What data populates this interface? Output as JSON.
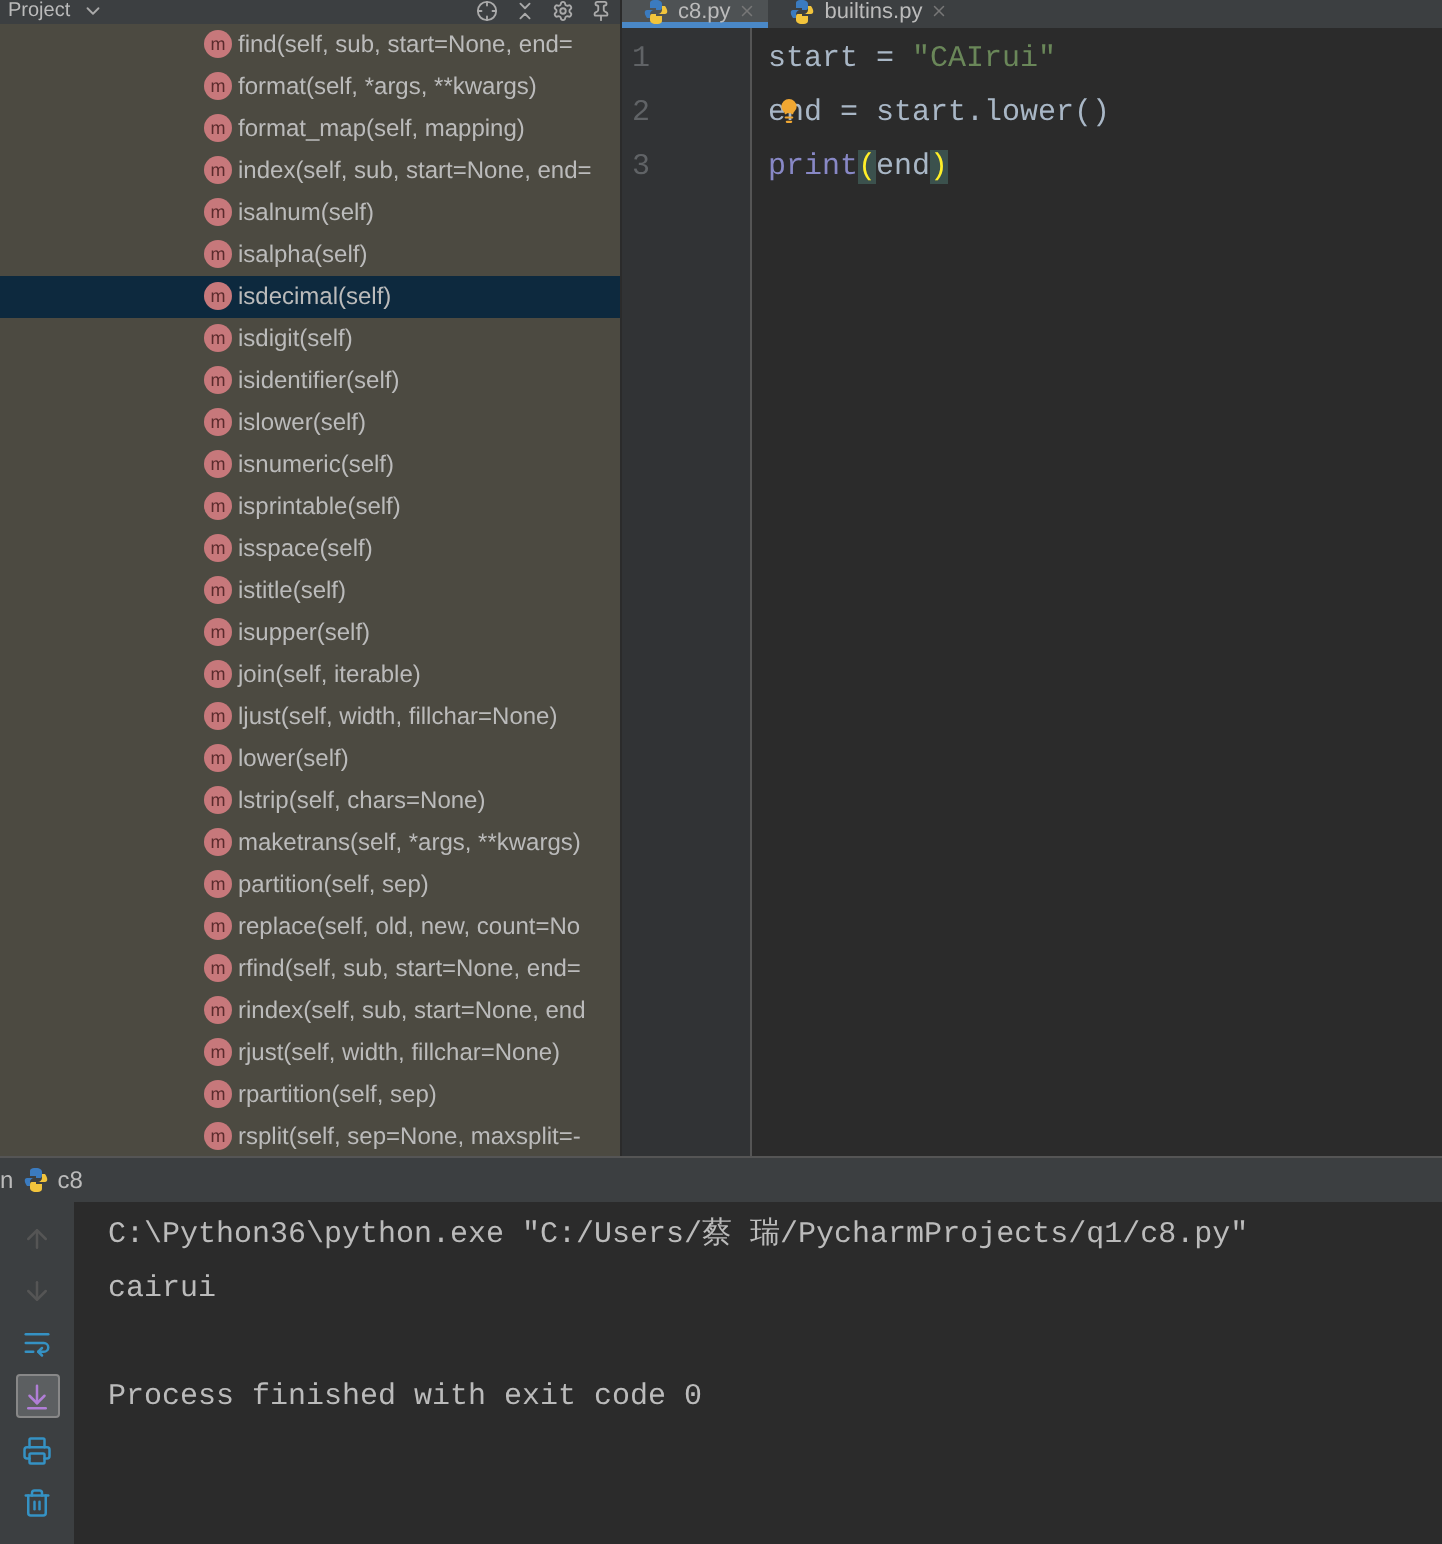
{
  "project_panel": {
    "title": "Project",
    "members": [
      {
        "icon": "m",
        "label": "find(self, sub, start=None, end=",
        "selected": false
      },
      {
        "icon": "m",
        "label": "format(self, *args, **kwargs)",
        "selected": false
      },
      {
        "icon": "m",
        "label": "format_map(self, mapping)",
        "selected": false
      },
      {
        "icon": "m",
        "label": "index(self, sub, start=None, end=",
        "selected": false
      },
      {
        "icon": "m",
        "label": "isalnum(self)",
        "selected": false
      },
      {
        "icon": "m",
        "label": "isalpha(self)",
        "selected": false
      },
      {
        "icon": "m",
        "label": "isdecimal(self)",
        "selected": true
      },
      {
        "icon": "m",
        "label": "isdigit(self)",
        "selected": false
      },
      {
        "icon": "m",
        "label": "isidentifier(self)",
        "selected": false
      },
      {
        "icon": "m",
        "label": "islower(self)",
        "selected": false
      },
      {
        "icon": "m",
        "label": "isnumeric(self)",
        "selected": false
      },
      {
        "icon": "m",
        "label": "isprintable(self)",
        "selected": false
      },
      {
        "icon": "m",
        "label": "isspace(self)",
        "selected": false
      },
      {
        "icon": "m",
        "label": "istitle(self)",
        "selected": false
      },
      {
        "icon": "m",
        "label": "isupper(self)",
        "selected": false
      },
      {
        "icon": "m",
        "label": "join(self, iterable)",
        "selected": false
      },
      {
        "icon": "m",
        "label": "ljust(self, width, fillchar=None)",
        "selected": false
      },
      {
        "icon": "m",
        "label": "lower(self)",
        "selected": false
      },
      {
        "icon": "m",
        "label": "lstrip(self, chars=None)",
        "selected": false
      },
      {
        "icon": "m",
        "label": "maketrans(self, *args, **kwargs)",
        "selected": false
      },
      {
        "icon": "m",
        "label": "partition(self, sep)",
        "selected": false
      },
      {
        "icon": "m",
        "label": "replace(self, old, new, count=No",
        "selected": false
      },
      {
        "icon": "m",
        "label": "rfind(self, sub, start=None, end=",
        "selected": false
      },
      {
        "icon": "m",
        "label": "rindex(self, sub, start=None, end",
        "selected": false
      },
      {
        "icon": "m",
        "label": "rjust(self, width, fillchar=None)",
        "selected": false
      },
      {
        "icon": "m",
        "label": "rpartition(self, sep)",
        "selected": false
      },
      {
        "icon": "m",
        "label": "rsplit(self, sep=None, maxsplit=-",
        "selected": false
      }
    ]
  },
  "editor": {
    "tabs": [
      {
        "label": "c8.py",
        "selected": true
      },
      {
        "label": "builtins.py",
        "selected": false
      }
    ],
    "lines": [
      {
        "number": "1",
        "tokens": [
          {
            "text": "start = ",
            "kind": "plain"
          },
          {
            "text": "\"CAIrui\"",
            "kind": "string"
          }
        ]
      },
      {
        "number": "2",
        "tokens": [
          {
            "text": "end = start.lower()",
            "kind": "plain"
          }
        ]
      },
      {
        "number": "3",
        "tokens": [
          {
            "text": "print",
            "kind": "builtin"
          },
          {
            "text": "(",
            "kind": "brace"
          },
          {
            "text": "end",
            "kind": "plain"
          },
          {
            "text": ")",
            "kind": "brace"
          }
        ]
      }
    ]
  },
  "run_panel": {
    "title_cut": "n",
    "config": "c8",
    "console": [
      {
        "text": "C:\\Python36\\python.exe \"C:/Users/蔡 瑞/PycharmProjects/q1/c8.py\"",
        "kind": "command"
      },
      {
        "text": "cairui",
        "kind": "output"
      },
      {
        "text": "Process finished with exit code 0",
        "kind": "status"
      }
    ]
  }
}
